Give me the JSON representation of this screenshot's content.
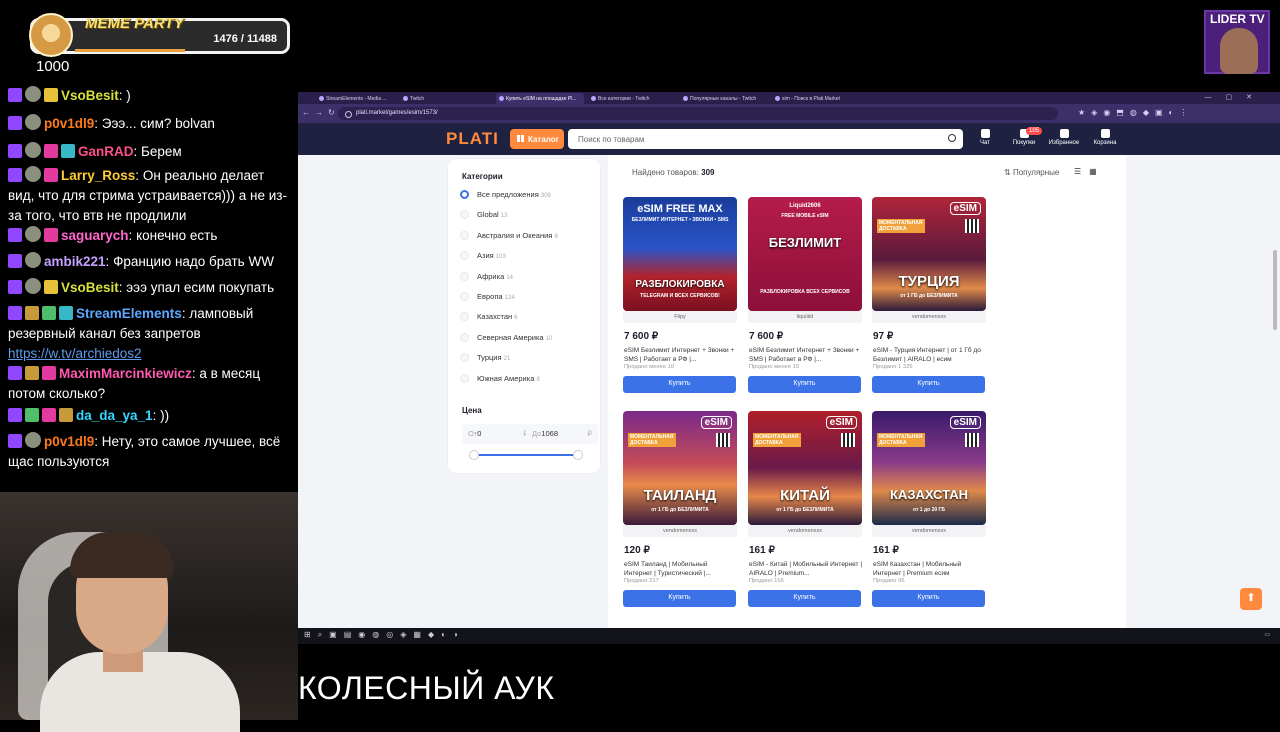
{
  "overlay": {
    "meme_party": {
      "title": "MEME PARTY",
      "count": "1476 / 11488"
    },
    "counter": "1000",
    "channel_logo": "LIDER TV",
    "caption": "КОЛЕСНЫЙ АУК"
  },
  "chat": [
    {
      "nick": "VsoBesit",
      "color": "#d8e03a",
      "text": ")"
    },
    {
      "nick": "p0v1dl9",
      "color": "#ff7a1a",
      "text": "Эээ... сим? bolvan"
    },
    {
      "nick": "GanRAD",
      "color": "#ff4f8b",
      "text": "Берем"
    },
    {
      "nick": "Larry_Ross",
      "color": "#ffcc33",
      "text": "Он реально делает вид, что для стрима устраивается))) а не из-за того, что втв не продлили"
    },
    {
      "nick": "saguarych",
      "color": "#ff66cc",
      "text": "конечно есть"
    },
    {
      "nick": "ambik221",
      "color": "#c4a1ff",
      "text": "Францию надо брать WW"
    },
    {
      "nick": "VsoBesit",
      "color": "#d8e03a",
      "text": "эээ упал есим покупать"
    },
    {
      "nick": "StreamElements",
      "color": "#5aa8ff",
      "text": "ламповый резервный канал без запретов",
      "link": "https://w.tv/archiedos2"
    },
    {
      "nick": "MaximMarcinkiewicz",
      "color": "#ff5ab0",
      "text": "а в месяц потом сколько?"
    },
    {
      "nick": "da_da_ya_1",
      "color": "#33d6ff",
      "text": "))"
    },
    {
      "nick": "p0v1dl9",
      "color": "#ff7a1a",
      "text": "Нету, это самое лучшее, всё щас пользуются"
    }
  ],
  "browser": {
    "tabs": [
      "StreamElements - Media ...",
      "Twitch",
      "Купить eSIM на площадке Pl...",
      "Все категории - Twitch",
      "Популярные каналы - Twitch",
      "sim - Поиск в Plati.Market"
    ],
    "active_tab": 2,
    "url": "plati.market/games/esim/1573/"
  },
  "plati": {
    "logo": "PLATI",
    "catalog_label": "Каталог",
    "search_placeholder": "Поиск по товарам",
    "header_buttons": [
      {
        "icon": "chat-icon",
        "label": "Чат"
      },
      {
        "icon": "purchases-icon",
        "label": "Покупки"
      },
      {
        "icon": "heart-icon",
        "label": "Избранное"
      },
      {
        "icon": "cart-icon",
        "label": "Корзина"
      }
    ],
    "purchases_badge": "105",
    "sidebar": {
      "title": "Категории",
      "categories": [
        {
          "label": "Все предложения",
          "count": "309",
          "selected": true
        },
        {
          "label": "Global",
          "count": "13"
        },
        {
          "label": "Австралия и Океания",
          "count": "8"
        },
        {
          "label": "Азия",
          "count": "103"
        },
        {
          "label": "Африка",
          "count": "14"
        },
        {
          "label": "Европа",
          "count": "124"
        },
        {
          "label": "Казахстан",
          "count": "6"
        },
        {
          "label": "Северная Америка",
          "count": "10"
        },
        {
          "label": "Турция",
          "count": "21"
        },
        {
          "label": "Южная Америка",
          "count": "8"
        }
      ],
      "price_title": "Цена",
      "price_from_label": "От",
      "price_from": "0",
      "price_to_label": "До",
      "price_to": "1068",
      "currency": "₽"
    },
    "found_label": "Найдено товаров:",
    "found_count": "309",
    "sort_label": "Популярные",
    "buy_label": "Купить",
    "products": [
      {
        "seller": "Flipy",
        "price": "7 600 ₽",
        "desc": "eSIM Безлимит Интернет + Звонки + SMS | Работает в РФ |...",
        "sold": "Продано менее 10",
        "img": {
          "bg": "linear-gradient(180deg,#1a3c9a,#2a55c9 45%,#b3222b 70%,#7a1020)",
          "top": "eSIM FREE MAX",
          "top2": "БЕЗЛИМИТ ИНТЕРНЕТ • ЗВОНКИ • SMS",
          "country": "РАЗБЛОКИРОВКА",
          "sub": "TELEGRAM И ВСЕХ СЕРВИСОВ!"
        }
      },
      {
        "seller": "liquiiiid",
        "price": "7 600 ₽",
        "desc": "eSIM Безлимит Интернет + Звонки + SMS | Работает в РФ |...",
        "sold": "Продано менее 10",
        "img": {
          "bg": "linear-gradient(180deg,#b51c4b,#8d0f3a)",
          "top": "Liquid2606",
          "top2": "FREE MOBILE eSIM",
          "country": "БЕЗЛИМИТ",
          "sub": "РАЗБЛОКИРОВКА ВСЕХ СЕРВИСОВ"
        }
      },
      {
        "seller": "vendomenxxx",
        "price": "97 ₽",
        "desc": "eSIM - Турция Интернет | от 1 Гб до Безлимит | AIRALO | есим",
        "sold": "Продано 1 325",
        "img": {
          "bg": "linear-gradient(180deg,#b0253a,#5a1a3d 55%,#e08a4a 80%,#2a1a3a)",
          "country": "ТУРЦИЯ",
          "sub": "от 1 ГБ до БЕЗЛИМИТА",
          "esim": true
        }
      },
      {
        "seller": "vendomenxxx",
        "price": "120 ₽",
        "desc": "eSIM Таиланд | Мобильный Интернет | Туристический |...",
        "sold": "Продано 217",
        "img": {
          "bg": "linear-gradient(180deg,#7a2a8a,#c24a5a 45%,#e88a4a 65%,#3a1a3a)",
          "country": "ТАИЛАНД",
          "sub": "от 1 ГБ до БЕЗЛИМИТА",
          "esim": true
        }
      },
      {
        "seller": "vendomenxxx",
        "price": "161 ₽",
        "desc": "eSIM - Китай | Мобильный Интернет | AIRALO | Premium...",
        "sold": "Продано 156",
        "img": {
          "bg": "linear-gradient(180deg,#b01f2a,#6a1a4a 50%,#e6874a 75%,#2a1a3a)",
          "country": "КИТАЙ",
          "sub": "от 1 ГБ до БЕЗЛИМИТА",
          "esim": true
        }
      },
      {
        "seller": "vendomenxxx",
        "price": "161 ₽",
        "desc": "eSIM Казахстан | Мобильный Интернет | Premium есим",
        "sold": "Продано 06",
        "img": {
          "bg": "linear-gradient(180deg,#3a1a6a,#8a3a8a 45%,#e08a4a 70%,#1a2a4a)",
          "country": "КАЗАХСТАН",
          "sub": "от 1 до 20 ГБ",
          "esim": true
        }
      }
    ]
  },
  "colors": {
    "accent": "#3b72e8",
    "brand_orange": "#ff8a3d",
    "header_bg": "#1e2240"
  }
}
